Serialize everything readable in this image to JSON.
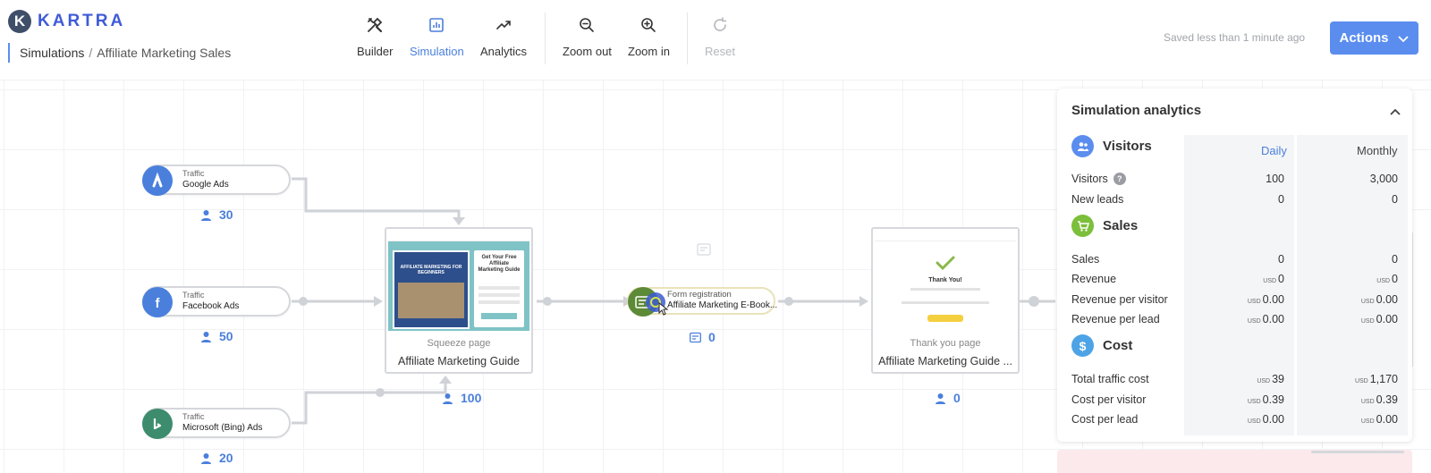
{
  "app": {
    "logo_letter": "K",
    "logo_text": "KARTRA"
  },
  "breadcrumb": {
    "section": "Simulations",
    "separator": "/",
    "page": "Affiliate Marketing Sales"
  },
  "toolbar": {
    "builder": "Builder",
    "simulation": "Simulation",
    "analytics": "Analytics",
    "zoom_out": "Zoom out",
    "zoom_in": "Zoom in",
    "reset": "Reset"
  },
  "status": {
    "saved": "Saved less than 1 minute ago"
  },
  "actions": {
    "label": "Actions"
  },
  "funnel": {
    "traffic_sources": [
      {
        "kind": "Traffic",
        "name": "Google Ads",
        "visitors": "30",
        "color": "#4a7fdc",
        "icon": "google-ads-icon"
      },
      {
        "kind": "Traffic",
        "name": "Facebook Ads",
        "visitors": "50",
        "color": "#4a7fdc",
        "icon": "facebook-icon"
      },
      {
        "kind": "Traffic",
        "name": "Microsoft (Bing) Ads",
        "visitors": "20",
        "color": "#3d8c6e",
        "icon": "bing-icon"
      }
    ],
    "squeeze_page": {
      "type": "Squeeze page",
      "name": "Affiliate Marketing Guide",
      "visitors": "100",
      "thumb_headline": "Get Your Free Affiliate Marketing Guide",
      "thumb_book": "AFFILIATE MARKETING FOR BEGINNERS"
    },
    "form": {
      "kind": "Form registration",
      "name": "Affiliate Marketing E-Book...",
      "count": "0"
    },
    "thank_you_page": {
      "type": "Thank you page",
      "name": "Affiliate Marketing Guide ...",
      "visitors": "0",
      "thumb_heading": "Thank You!"
    }
  },
  "analytics": {
    "title": "Simulation analytics",
    "columns": {
      "daily": "Daily",
      "monthly": "Monthly"
    },
    "currency": "USD",
    "visitors_section": {
      "title": "Visitors",
      "rows": [
        {
          "label": "Visitors",
          "daily": "100",
          "monthly": "3,000"
        },
        {
          "label": "New leads",
          "daily": "0",
          "monthly": "0"
        }
      ]
    },
    "sales_section": {
      "title": "Sales",
      "rows": [
        {
          "label": "Sales",
          "daily": "0",
          "monthly": "0"
        },
        {
          "label": "Revenue",
          "daily": "0",
          "monthly": "0"
        },
        {
          "label": "Revenue per visitor",
          "daily": "0.00",
          "monthly": "0.00"
        },
        {
          "label": "Revenue per lead",
          "daily": "0.00",
          "monthly": "0.00"
        }
      ]
    },
    "cost_section": {
      "title": "Cost",
      "rows": [
        {
          "label": "Total traffic cost",
          "daily": "39",
          "monthly": "1,170"
        },
        {
          "label": "Cost per visitor",
          "daily": "0.39",
          "monthly": "0.39"
        },
        {
          "label": "Cost per lead",
          "daily": "0.00",
          "monthly": "0.00"
        }
      ]
    }
  },
  "colors": {
    "accent": "#5b8def",
    "active_tab": "#4a7fdc",
    "visitors_icon": "#5b8def",
    "sales_icon": "#7cbf3a",
    "cost_icon": "#4da3e6",
    "form_icon": "#5d8a37"
  }
}
